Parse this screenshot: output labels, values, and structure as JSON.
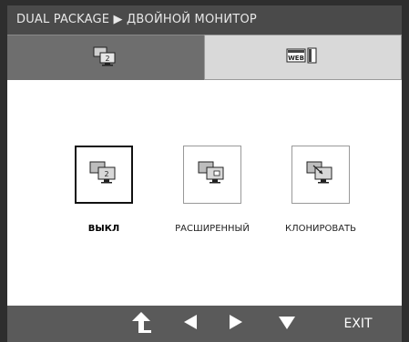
{
  "title": "DUAL PACKAGE ▶ ДВОЙНОЙ МОНИТОР",
  "tabs": [
    {
      "icon": "dual-monitor-icon",
      "badge": "2",
      "active": true
    },
    {
      "icon": "dual-web-icon",
      "badge": "WEB",
      "active": false
    }
  ],
  "options": [
    {
      "label": "ВЫКЛ",
      "icon": "single-monitor-icon",
      "badge": "2",
      "selected": true
    },
    {
      "label": "РАСШИРЕННЫЙ",
      "icon": "extend-monitor-icon",
      "selected": false
    },
    {
      "label": "КЛОНИРОВАТЬ",
      "icon": "clone-monitor-icon",
      "selected": false
    }
  ],
  "nav": {
    "up_icon": "return-up-icon",
    "left_icon": "left-triangle-icon",
    "right_icon": "right-triangle-icon",
    "down_icon": "down-triangle-icon",
    "exit_label": "EXIT"
  },
  "colors": {
    "frame": "#2e2e2e",
    "title_bg": "#4a4a4a",
    "tab_active": "#6e6e6e",
    "tab_inactive": "#d9d9d9",
    "nav_bg": "#5a5a5a"
  }
}
